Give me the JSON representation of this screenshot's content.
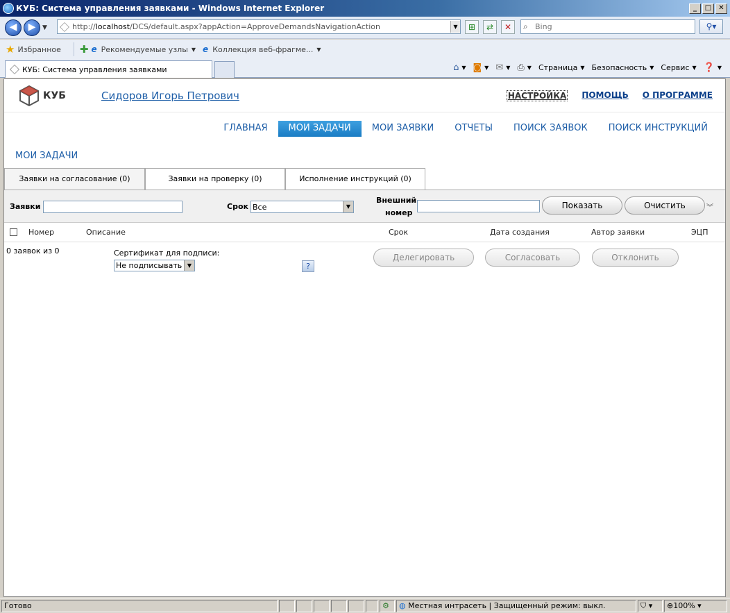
{
  "window": {
    "title": "КУБ: Система управления заявками - Windows Internet Explorer",
    "buttons": [
      "_",
      "□",
      "✕"
    ]
  },
  "browser": {
    "url_prefix": "http://",
    "url_host": "localhost",
    "url_rest": "/DCS/default.aspx?appAction=ApproveDemandsNavigationAction",
    "search_placeholder": "Bing",
    "favorites_label": "Избранное",
    "favorites_items": [
      "Рекомендуемые узлы",
      "Коллекция веб-фрагме..."
    ],
    "tab_title": "КУБ: Система управления заявками",
    "cmd_page": "Страница",
    "cmd_security": "Безопасность",
    "cmd_service": "Сервис"
  },
  "app": {
    "logo_text": "КУБ",
    "user_name": "Сидоров Игорь Петрович",
    "top_links": [
      "НАСТРОЙКА",
      "ПОМОЩЬ",
      "О ПРОГРАММЕ"
    ],
    "main_nav": [
      "ГЛАВНАЯ",
      "МОИ ЗАДАЧИ",
      "МОИ ЗАЯВКИ",
      "ОТЧЕТЫ",
      "ПОИСК ЗАЯВОК",
      "ПОИСК ИНСТРУКЦИЙ"
    ],
    "main_nav_active": "МОИ ЗАДАЧИ",
    "section_title": "МОИ ЗАДАЧИ",
    "subtabs": [
      "Заявки на согласование (0)",
      "Заявки на проверку (0)",
      "Исполнение инструкций (0)"
    ],
    "filters": {
      "demands_label": "Заявки",
      "term_label": "Срок",
      "term_value": "Все",
      "external_label_1": "Внешний",
      "external_label_2": "номер",
      "show_button": "Показать",
      "clear_button": "Очистить"
    },
    "grid": {
      "columns": [
        "Номер",
        "Описание",
        "Срок",
        "Дата создания",
        "Автор заявки",
        "ЭЦП"
      ],
      "count_text": "0 заявок из 0"
    },
    "signing": {
      "cert_label": "Сертификат для подписи:",
      "cert_value": "Не подписывать",
      "help": "?"
    },
    "actions": {
      "delegate": "Делегировать",
      "approve": "Согласовать",
      "reject": "Отклонить"
    }
  },
  "statusbar": {
    "left": "Готово",
    "zone": "Местная интрасеть | Защищенный режим: выкл.",
    "zoom": "100%"
  }
}
